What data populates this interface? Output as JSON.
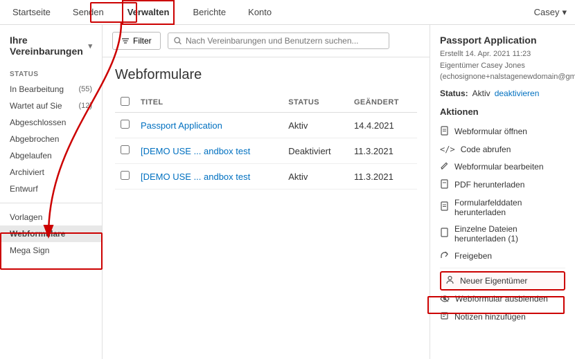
{
  "nav": {
    "items": [
      {
        "label": "Startseite",
        "active": false
      },
      {
        "label": "Senden",
        "active": false
      },
      {
        "label": "Verwalten",
        "active": true
      },
      {
        "label": "Berichte",
        "active": false
      },
      {
        "label": "Konto",
        "active": false
      }
    ],
    "user": "Casey",
    "user_chevron": "▾"
  },
  "sidebar": {
    "header": "Ihre Vereinbarungen",
    "chevron": "▾",
    "section_label": "STATUS",
    "items": [
      {
        "label": "In Bearbeitung",
        "count": "(55)"
      },
      {
        "label": "Wartet auf Sie",
        "count": "(12)"
      },
      {
        "label": "Abgeschlossen",
        "count": ""
      },
      {
        "label": "Abgebrochen",
        "count": ""
      },
      {
        "label": "Abgelaufen",
        "count": ""
      },
      {
        "label": "Archiviert",
        "count": ""
      },
      {
        "label": "Entwurf",
        "count": ""
      }
    ],
    "bottom_items": [
      {
        "label": "Vorlagen",
        "selected": false
      },
      {
        "label": "Webformulare",
        "selected": true
      },
      {
        "label": "Mega Sign",
        "selected": false
      }
    ]
  },
  "toolbar": {
    "filter_label": "Filter",
    "search_placeholder": "Nach Vereinbarungen und Benutzern suchen..."
  },
  "table": {
    "title": "Webformulare",
    "columns": [
      "",
      "TITEL",
      "STATUS",
      "GEÄNDERT"
    ],
    "rows": [
      {
        "title": "Passport Application",
        "status": "Aktiv",
        "changed": "14.4.2021",
        "status_type": "active"
      },
      {
        "title": "[DEMO USE ... andbox test",
        "status": "Deaktiviert",
        "changed": "11.3.2021",
        "status_type": "deactivated"
      },
      {
        "title": "[DEMO USE ... andbox test",
        "status": "Aktiv",
        "changed": "11.3.2021",
        "status_type": "active"
      }
    ]
  },
  "panel": {
    "title": "Passport Application",
    "meta_line1": "Erstellt 14. Apr. 2021 11:23",
    "meta_line2": "Eigentümer Casey Jones",
    "meta_line3": "(echosignone+nalstagenewdomain@gmail.com)",
    "status_label": "Status:",
    "status_value": "Aktiv",
    "deactivate_label": "deaktivieren",
    "actions_title": "Aktionen",
    "actions": [
      {
        "icon": "📄",
        "label": "Webformular öffnen"
      },
      {
        "icon": "</>",
        "label": "Code abrufen"
      },
      {
        "icon": "✏️",
        "label": "Webformular bearbeiten"
      },
      {
        "icon": "📋",
        "label": "PDF herunterladen"
      },
      {
        "icon": "📋",
        "label": "Formularfelddaten herunterladen"
      },
      {
        "icon": "📋",
        "label": "Einzelne Dateien herunterladen (1)"
      },
      {
        "icon": "↗",
        "label": "Freigeben"
      },
      {
        "icon": "👤",
        "label": "Neuer Eigentümer",
        "highlighted": true
      },
      {
        "icon": "🔒",
        "label": "Webformular ausblenden"
      },
      {
        "icon": "💬",
        "label": "Notizen hinzufügen"
      }
    ]
  }
}
